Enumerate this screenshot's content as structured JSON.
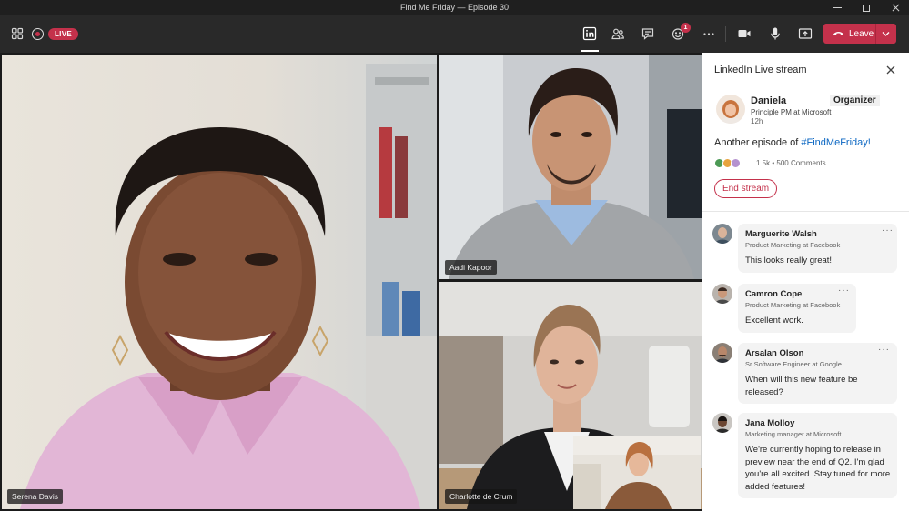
{
  "window": {
    "title": "Find Me Friday — Episode 30"
  },
  "toolbar": {
    "live_label": "LIVE",
    "reactions_badge": "1",
    "leave_label": "Leave",
    "accent": "#c4314b"
  },
  "participants": [
    {
      "name": "Serena Davis"
    },
    {
      "name": "Aadi Kapoor"
    },
    {
      "name": "Charlotte de Crum"
    }
  ],
  "panel": {
    "title": "LinkedIn Live stream",
    "organizer": {
      "name": "Daniela",
      "role": "Organizer",
      "subtitle": "Principle PM at Microsoft",
      "time": "12h"
    },
    "post": {
      "text": "Another episode of ",
      "hashtag": "#FindMeFriday!"
    },
    "stats": "1.5k • 500 Comments",
    "end_stream_label": "End stream",
    "comments": [
      {
        "name": "Marguerite Walsh",
        "subtitle": "Product Marketing at Facebook",
        "text": "This looks really great!"
      },
      {
        "name": "Camron Cope",
        "subtitle": "Product Marketing at Facebook",
        "text": "Excellent work."
      },
      {
        "name": "Arsalan Olson",
        "subtitle": "Sr Software Engineer at Google",
        "text": "When will this new feature be released?"
      },
      {
        "name": "Jana Molloy",
        "subtitle": "Marketing manager at Microsoft",
        "text": "We're currently hoping to release in preview near the end of Q2. I'm glad you're all excited. Stay tuned for more added features!"
      }
    ]
  }
}
